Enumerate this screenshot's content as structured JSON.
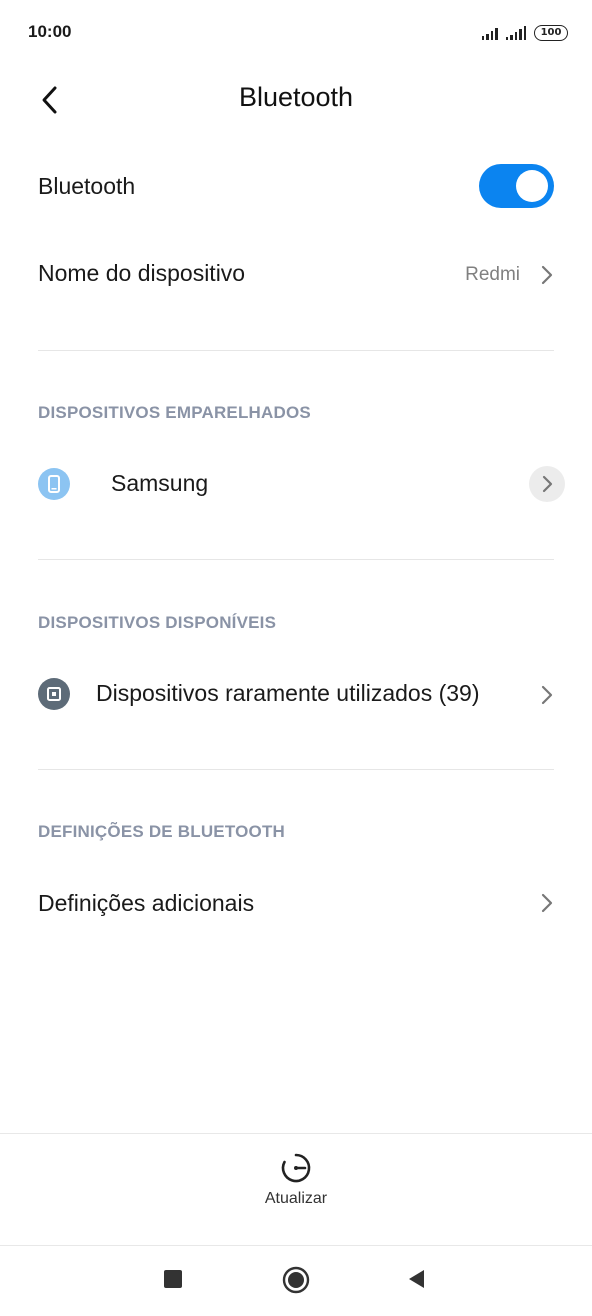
{
  "status_bar": {
    "time": "10:00",
    "battery": "100"
  },
  "header": {
    "title": "Bluetooth"
  },
  "bluetooth_toggle": {
    "label": "Bluetooth",
    "enabled": true,
    "accent": "#0b84f0"
  },
  "device_name": {
    "label": "Nome do dispositivo",
    "value": "Redmi"
  },
  "paired_section": {
    "header": "DISPOSITIVOS EMPARELHADOS",
    "devices": [
      {
        "name": "Samsung",
        "icon": "phone-icon",
        "icon_color": "#8cc4f2"
      }
    ]
  },
  "available_section": {
    "header": "DISPOSITIVOS DISPONÍVEIS",
    "items": [
      {
        "label": "Dispositivos raramente utilizados (39)",
        "icon": "device-icon",
        "icon_color": "#5d6b78"
      }
    ]
  },
  "settings_section": {
    "header": "DEFINIÇÕES DE BLUETOOTH",
    "items": [
      {
        "label": "Definições adicionais"
      }
    ]
  },
  "bottom_bar": {
    "refresh_label": "Atualizar"
  },
  "nav_bar": {
    "buttons": [
      "recents-icon",
      "home-icon",
      "back-icon"
    ]
  }
}
